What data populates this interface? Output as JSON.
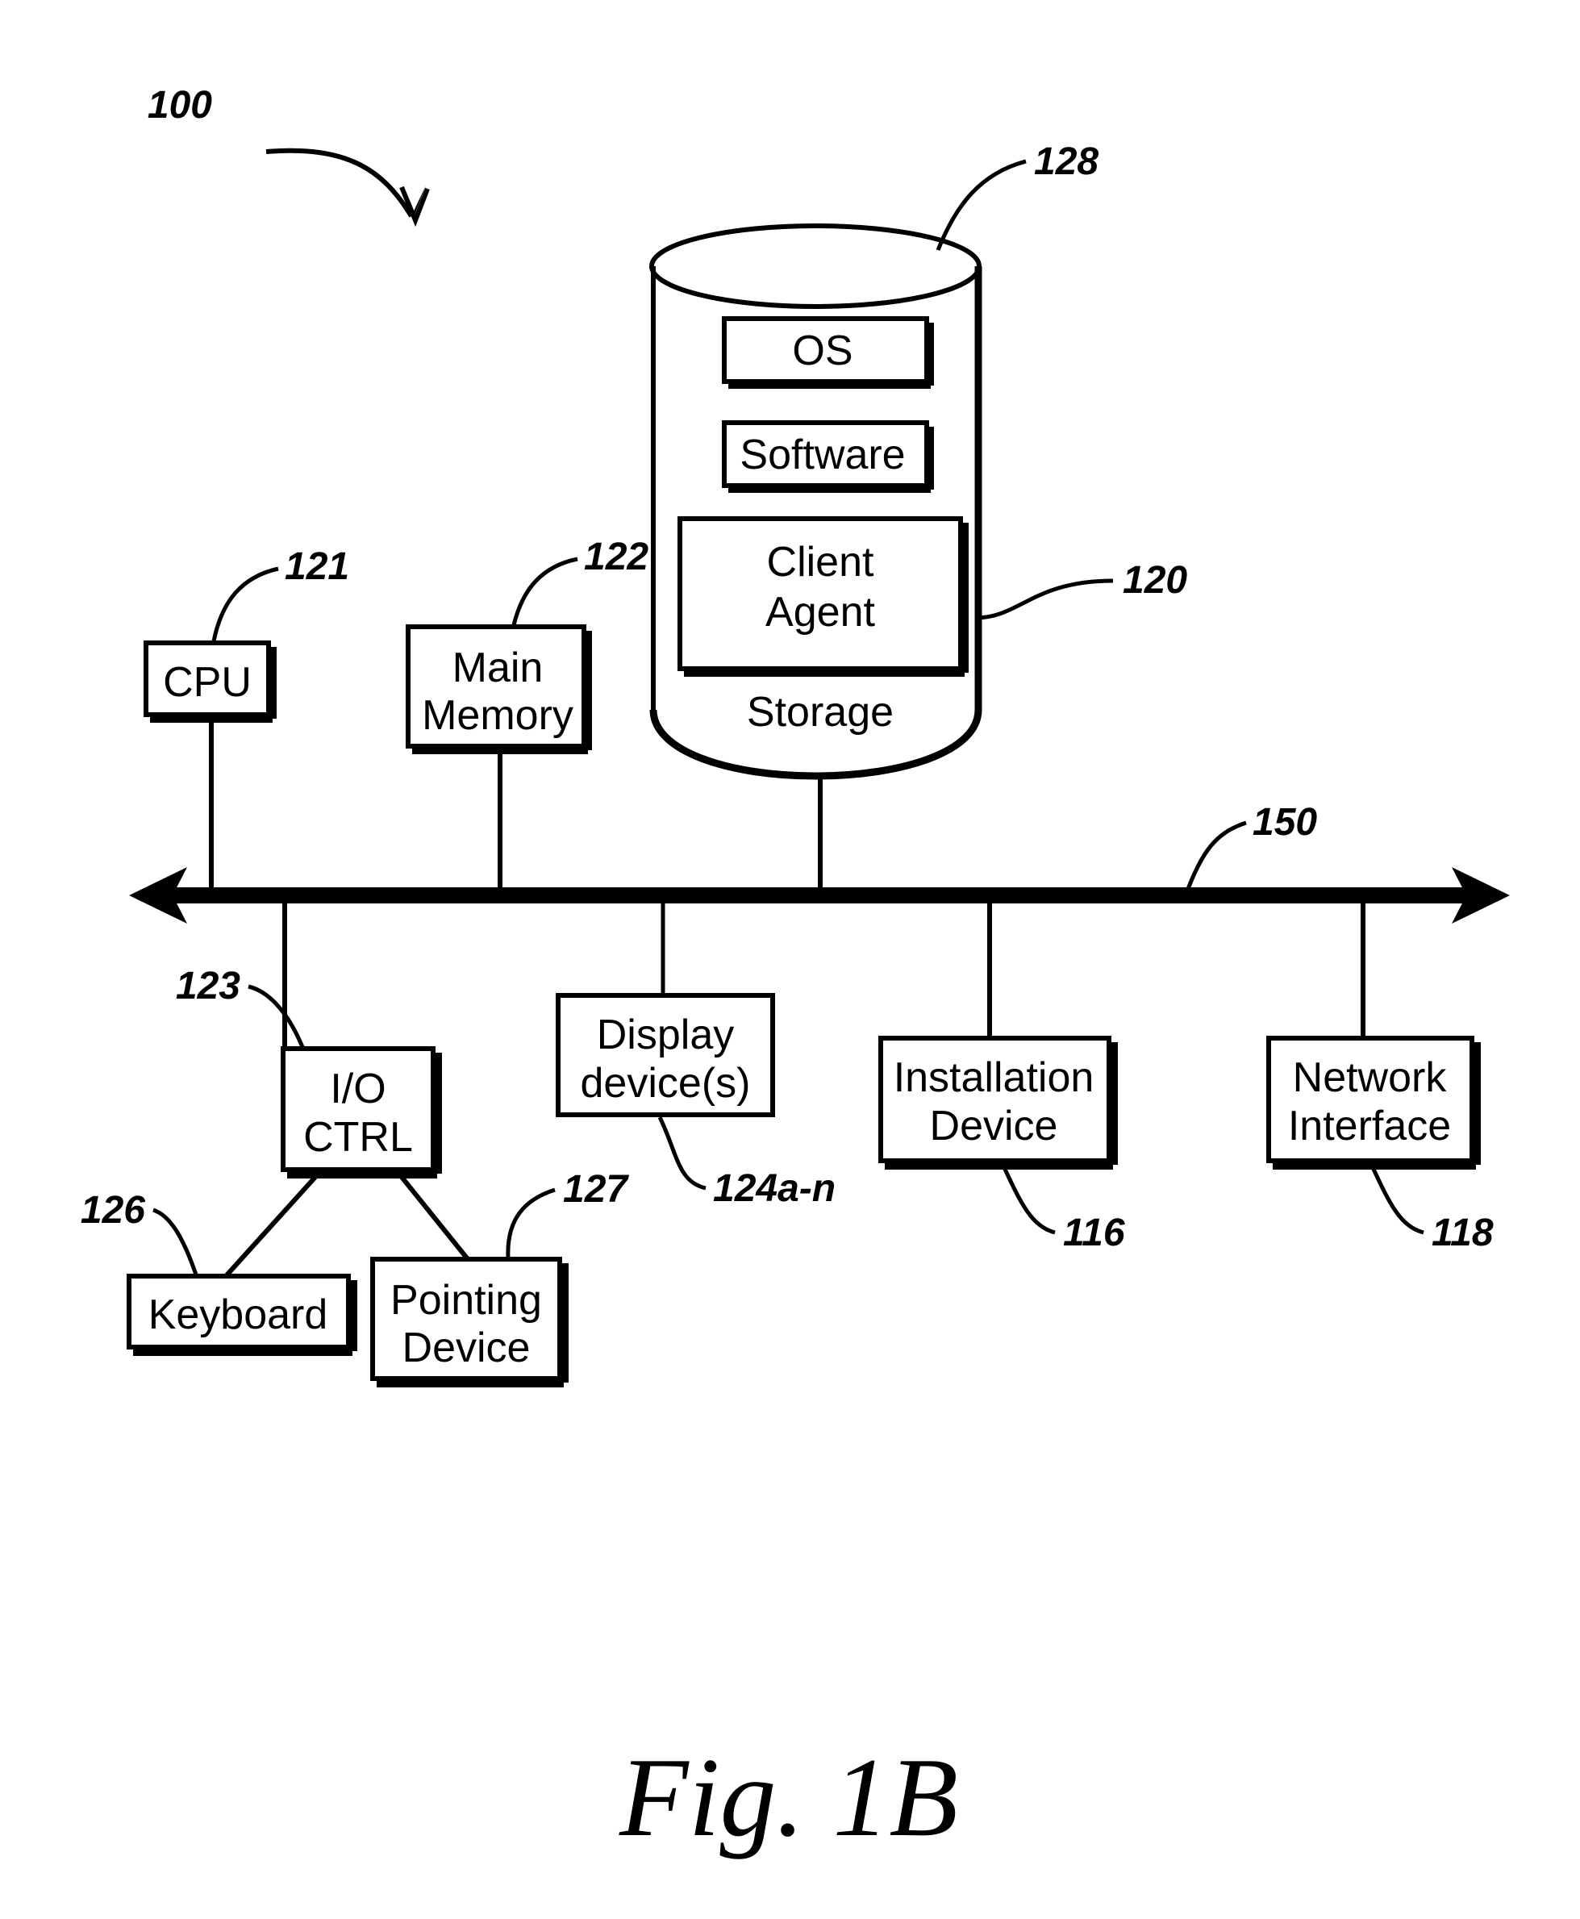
{
  "figure": {
    "caption": "Fig. 1B",
    "system_ref": "100"
  },
  "bus": {
    "label": "150",
    "name": "system-bus"
  },
  "storage": {
    "ref": "128",
    "cylinder_label": "Storage",
    "contents": [
      {
        "label": "OS",
        "name": "os-box"
      },
      {
        "label": "Software",
        "name": "software-box"
      },
      {
        "label": "Client\nAgent",
        "line1": "Client",
        "line2": "Agent",
        "name": "client-agent-box",
        "ref": "120"
      }
    ]
  },
  "components": {
    "cpu": {
      "label": "CPU",
      "ref": "121"
    },
    "main_memory": {
      "line1": "Main",
      "line2": "Memory",
      "ref": "122"
    },
    "io_ctrl": {
      "line1": "I/O",
      "line2": "CTRL",
      "ref": "123"
    },
    "display": {
      "line1": "Display",
      "line2": "device(s)",
      "ref": "124a-n"
    },
    "installation_device": {
      "line1": "Installation",
      "line2": "Device",
      "ref": "116"
    },
    "network_interface": {
      "line1": "Network",
      "line2": "Interface",
      "ref": "118"
    },
    "keyboard": {
      "label": "Keyboard",
      "ref": "126"
    },
    "pointing_device": {
      "line1": "Pointing",
      "line2": "Device",
      "ref": "127"
    }
  },
  "colors": {
    "ink": "#000000",
    "paper": "#ffffff"
  }
}
